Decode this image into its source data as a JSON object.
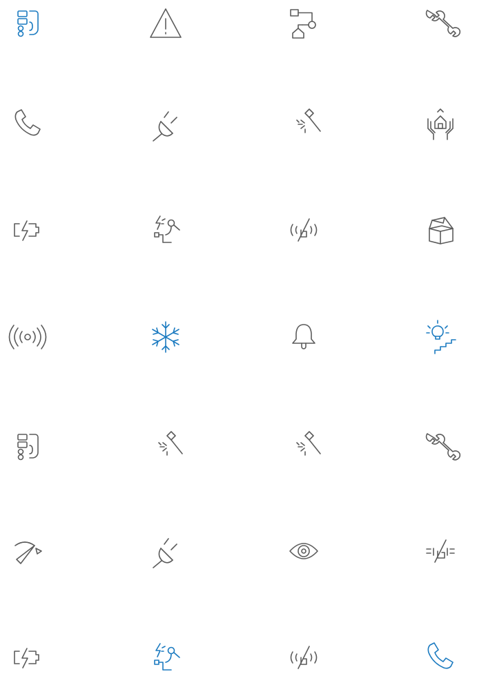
{
  "colors": {
    "gray": "#5b5b5b",
    "blue": "#1a7ac0"
  },
  "icon_grid": {
    "columns": 4,
    "rows": 7,
    "icons": [
      {
        "name": "door-station-icon",
        "color": "blue"
      },
      {
        "name": "warning-triangle-icon",
        "color": "gray"
      },
      {
        "name": "network-diagram-icon",
        "color": "gray"
      },
      {
        "name": "wrench-icon",
        "color": "gray"
      },
      {
        "name": "phone-icon",
        "color": "gray"
      },
      {
        "name": "plug-icon",
        "color": "gray"
      },
      {
        "name": "tamper-hammer-icon",
        "color": "gray"
      },
      {
        "name": "house-protection-icon",
        "color": "gray"
      },
      {
        "name": "battery-fault-icon",
        "color": "gray"
      },
      {
        "name": "sensor-fault-icon",
        "color": "gray"
      },
      {
        "name": "signal-blocked-icon",
        "color": "gray"
      },
      {
        "name": "open-box-icon",
        "color": "gray"
      },
      {
        "name": "wireless-signal-icon",
        "color": "gray"
      },
      {
        "name": "snowflake-icon",
        "color": "blue"
      },
      {
        "name": "bell-icon",
        "color": "gray"
      },
      {
        "name": "stair-light-icon",
        "color": "blue"
      },
      {
        "name": "door-station-icon",
        "color": "gray"
      },
      {
        "name": "tamper-hammer-icon",
        "color": "gray"
      },
      {
        "name": "tamper-hammer-icon",
        "color": "gray"
      },
      {
        "name": "wrench-icon",
        "color": "gray"
      },
      {
        "name": "horn-icon",
        "color": "gray"
      },
      {
        "name": "plug-icon",
        "color": "gray"
      },
      {
        "name": "eye-icon",
        "color": "gray"
      },
      {
        "name": "bus-line-fault-icon",
        "color": "gray"
      },
      {
        "name": "battery-fault-icon",
        "color": "gray"
      },
      {
        "name": "sensor-fault-icon",
        "color": "blue"
      },
      {
        "name": "signal-blocked-icon",
        "color": "gray"
      },
      {
        "name": "phone-icon",
        "color": "blue"
      }
    ]
  }
}
